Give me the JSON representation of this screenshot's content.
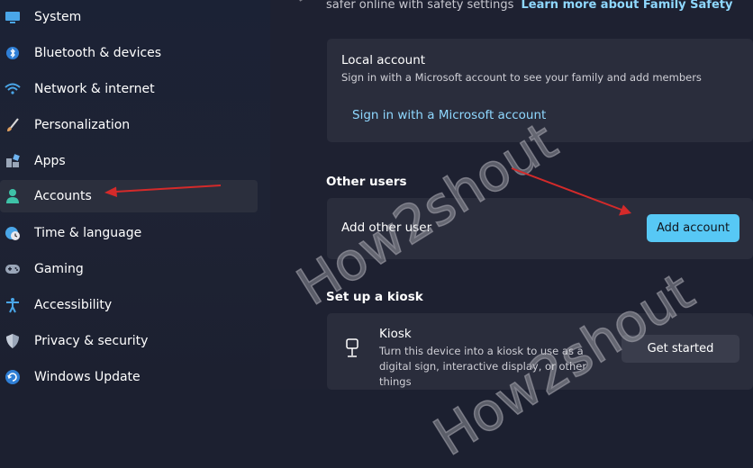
{
  "sidebar": {
    "items": [
      {
        "label": "System",
        "icon": "monitor-icon"
      },
      {
        "label": "Bluetooth & devices",
        "icon": "bluetooth-icon"
      },
      {
        "label": "Network & internet",
        "icon": "wifi-icon"
      },
      {
        "label": "Personalization",
        "icon": "brush-icon"
      },
      {
        "label": "Apps",
        "icon": "apps-icon"
      },
      {
        "label": "Accounts",
        "icon": "person-icon",
        "selected": true
      },
      {
        "label": "Time & language",
        "icon": "globe-clock-icon"
      },
      {
        "label": "Gaming",
        "icon": "gamepad-icon"
      },
      {
        "label": "Accessibility",
        "icon": "accessibility-icon"
      },
      {
        "label": "Privacy & security",
        "icon": "shield-icon"
      },
      {
        "label": "Windows Update",
        "icon": "update-icon"
      }
    ]
  },
  "family": {
    "info_text": "safer online with safety settings",
    "learn_more_link": "Learn more about Family Safety"
  },
  "local_account": {
    "title": "Local account",
    "description": "Sign in with a Microsoft account to see your family and add members",
    "sign_in_link": "Sign in with a Microsoft account"
  },
  "other_users": {
    "section_title": "Other users",
    "add_label": "Add other user",
    "add_button": "Add account"
  },
  "kiosk": {
    "section_title": "Set up a kiosk",
    "title": "Kiosk",
    "description": "Turn this device into a kiosk to use as a digital sign, interactive display, or other things",
    "button": "Get started"
  },
  "watermark": {
    "text": "How2shout"
  },
  "colors": {
    "accent": "#57c8f5",
    "link": "#8fd8ff",
    "annotation_arrow": "#d42a2a",
    "card_bg": "#2a2d3c"
  }
}
